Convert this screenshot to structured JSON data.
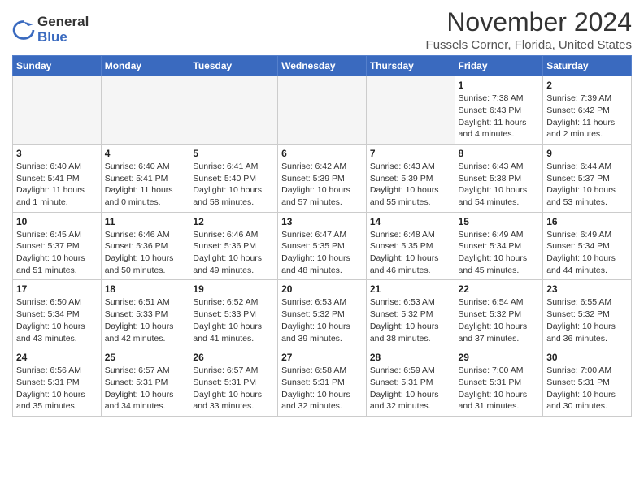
{
  "logo": {
    "general": "General",
    "blue": "Blue"
  },
  "title": "November 2024",
  "subtitle": "Fussels Corner, Florida, United States",
  "days_of_week": [
    "Sunday",
    "Monday",
    "Tuesday",
    "Wednesday",
    "Thursday",
    "Friday",
    "Saturday"
  ],
  "weeks": [
    [
      {
        "day": "",
        "info": ""
      },
      {
        "day": "",
        "info": ""
      },
      {
        "day": "",
        "info": ""
      },
      {
        "day": "",
        "info": ""
      },
      {
        "day": "",
        "info": ""
      },
      {
        "day": "1",
        "info": "Sunrise: 7:38 AM\nSunset: 6:43 PM\nDaylight: 11 hours\nand 4 minutes."
      },
      {
        "day": "2",
        "info": "Sunrise: 7:39 AM\nSunset: 6:42 PM\nDaylight: 11 hours\nand 2 minutes."
      }
    ],
    [
      {
        "day": "3",
        "info": "Sunrise: 6:40 AM\nSunset: 5:41 PM\nDaylight: 11 hours\nand 1 minute."
      },
      {
        "day": "4",
        "info": "Sunrise: 6:40 AM\nSunset: 5:41 PM\nDaylight: 11 hours\nand 0 minutes."
      },
      {
        "day": "5",
        "info": "Sunrise: 6:41 AM\nSunset: 5:40 PM\nDaylight: 10 hours\nand 58 minutes."
      },
      {
        "day": "6",
        "info": "Sunrise: 6:42 AM\nSunset: 5:39 PM\nDaylight: 10 hours\nand 57 minutes."
      },
      {
        "day": "7",
        "info": "Sunrise: 6:43 AM\nSunset: 5:39 PM\nDaylight: 10 hours\nand 55 minutes."
      },
      {
        "day": "8",
        "info": "Sunrise: 6:43 AM\nSunset: 5:38 PM\nDaylight: 10 hours\nand 54 minutes."
      },
      {
        "day": "9",
        "info": "Sunrise: 6:44 AM\nSunset: 5:37 PM\nDaylight: 10 hours\nand 53 minutes."
      }
    ],
    [
      {
        "day": "10",
        "info": "Sunrise: 6:45 AM\nSunset: 5:37 PM\nDaylight: 10 hours\nand 51 minutes."
      },
      {
        "day": "11",
        "info": "Sunrise: 6:46 AM\nSunset: 5:36 PM\nDaylight: 10 hours\nand 50 minutes."
      },
      {
        "day": "12",
        "info": "Sunrise: 6:46 AM\nSunset: 5:36 PM\nDaylight: 10 hours\nand 49 minutes."
      },
      {
        "day": "13",
        "info": "Sunrise: 6:47 AM\nSunset: 5:35 PM\nDaylight: 10 hours\nand 48 minutes."
      },
      {
        "day": "14",
        "info": "Sunrise: 6:48 AM\nSunset: 5:35 PM\nDaylight: 10 hours\nand 46 minutes."
      },
      {
        "day": "15",
        "info": "Sunrise: 6:49 AM\nSunset: 5:34 PM\nDaylight: 10 hours\nand 45 minutes."
      },
      {
        "day": "16",
        "info": "Sunrise: 6:49 AM\nSunset: 5:34 PM\nDaylight: 10 hours\nand 44 minutes."
      }
    ],
    [
      {
        "day": "17",
        "info": "Sunrise: 6:50 AM\nSunset: 5:34 PM\nDaylight: 10 hours\nand 43 minutes."
      },
      {
        "day": "18",
        "info": "Sunrise: 6:51 AM\nSunset: 5:33 PM\nDaylight: 10 hours\nand 42 minutes."
      },
      {
        "day": "19",
        "info": "Sunrise: 6:52 AM\nSunset: 5:33 PM\nDaylight: 10 hours\nand 41 minutes."
      },
      {
        "day": "20",
        "info": "Sunrise: 6:53 AM\nSunset: 5:32 PM\nDaylight: 10 hours\nand 39 minutes."
      },
      {
        "day": "21",
        "info": "Sunrise: 6:53 AM\nSunset: 5:32 PM\nDaylight: 10 hours\nand 38 minutes."
      },
      {
        "day": "22",
        "info": "Sunrise: 6:54 AM\nSunset: 5:32 PM\nDaylight: 10 hours\nand 37 minutes."
      },
      {
        "day": "23",
        "info": "Sunrise: 6:55 AM\nSunset: 5:32 PM\nDaylight: 10 hours\nand 36 minutes."
      }
    ],
    [
      {
        "day": "24",
        "info": "Sunrise: 6:56 AM\nSunset: 5:31 PM\nDaylight: 10 hours\nand 35 minutes."
      },
      {
        "day": "25",
        "info": "Sunrise: 6:57 AM\nSunset: 5:31 PM\nDaylight: 10 hours\nand 34 minutes."
      },
      {
        "day": "26",
        "info": "Sunrise: 6:57 AM\nSunset: 5:31 PM\nDaylight: 10 hours\nand 33 minutes."
      },
      {
        "day": "27",
        "info": "Sunrise: 6:58 AM\nSunset: 5:31 PM\nDaylight: 10 hours\nand 32 minutes."
      },
      {
        "day": "28",
        "info": "Sunrise: 6:59 AM\nSunset: 5:31 PM\nDaylight: 10 hours\nand 32 minutes."
      },
      {
        "day": "29",
        "info": "Sunrise: 7:00 AM\nSunset: 5:31 PM\nDaylight: 10 hours\nand 31 minutes."
      },
      {
        "day": "30",
        "info": "Sunrise: 7:00 AM\nSunset: 5:31 PM\nDaylight: 10 hours\nand 30 minutes."
      }
    ]
  ]
}
